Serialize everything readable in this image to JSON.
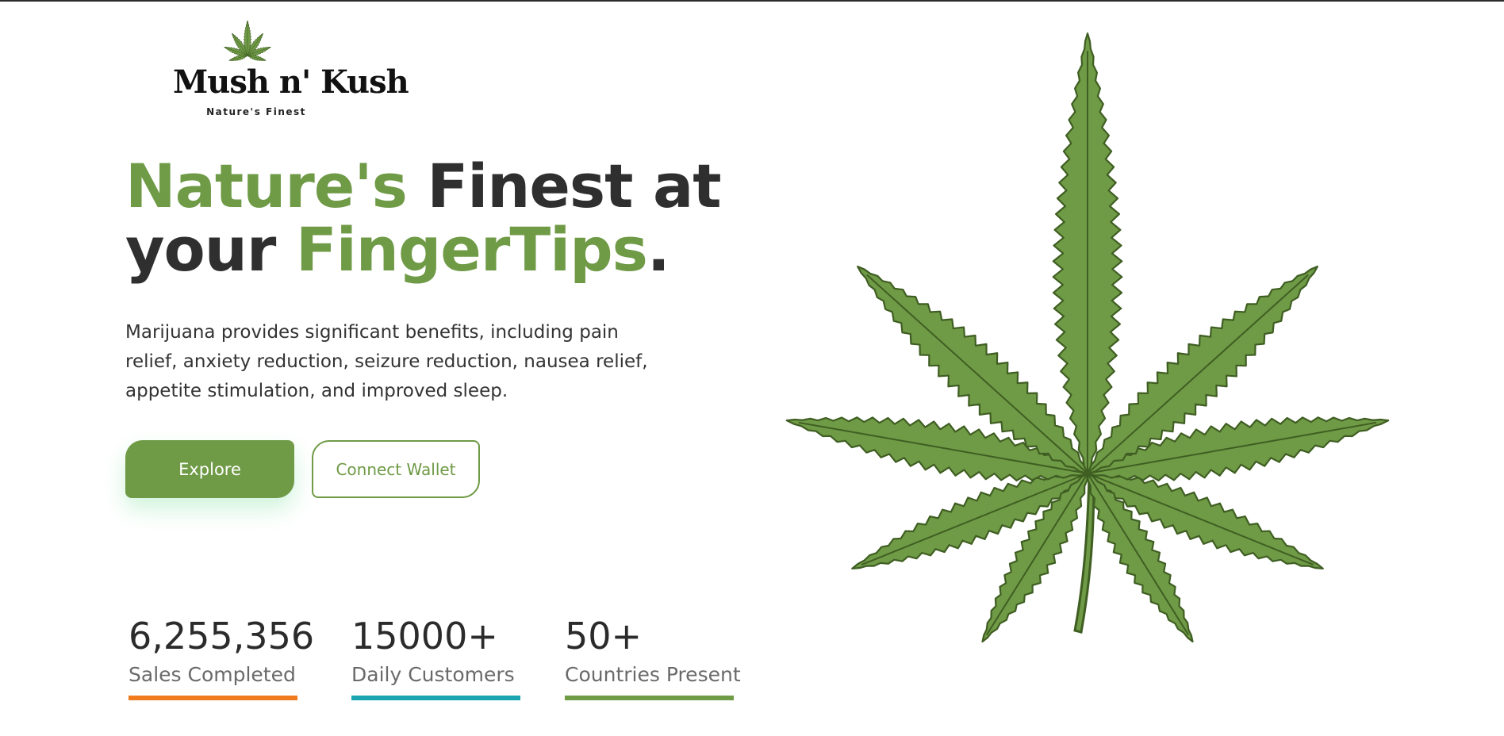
{
  "logo": {
    "wordmark": "Mush n' Kush",
    "tagline": "Nature's Finest"
  },
  "hero": {
    "headline": {
      "part1": "Nature's",
      "part2": " Finest at",
      "part3": "your ",
      "part4": "FingerTips",
      "part5": "."
    },
    "description": "Marijuana provides significant benefits, including pain relief, anxiety reduction, seizure reduction, nausea relief, appetite stimulation, and improved sleep.",
    "buttons": {
      "explore": "Explore",
      "connect_wallet": "Connect Wallet"
    }
  },
  "stats": [
    {
      "value": "6,255,356",
      "label": "Sales Completed",
      "color": "#f07b1f"
    },
    {
      "value": "15000+",
      "label": "Daily Customers",
      "color": "#1aa5b0"
    },
    {
      "value": "50+",
      "label": "Countries Present",
      "color": "#6f9a46"
    }
  ],
  "colors": {
    "brand_green": "#6f9a46",
    "leaf_green": "#6f9a46",
    "leaf_outline": "#3f5e22",
    "text_dark": "#2f2f2f"
  },
  "icons": {
    "logo_leaf": "cannabis-leaf-icon",
    "hero_image": "cannabis-leaf-illustration"
  }
}
